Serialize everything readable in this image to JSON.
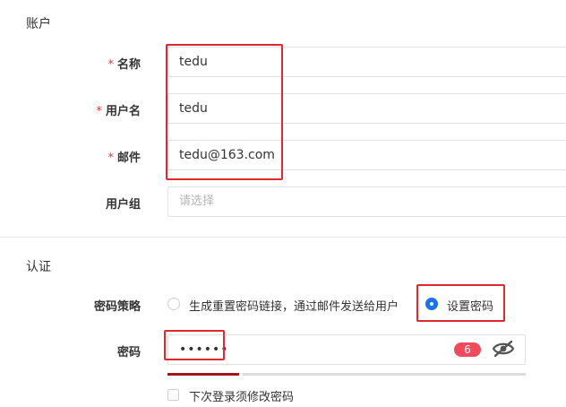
{
  "account_section": {
    "title": "账户",
    "name": {
      "required_mark": "*",
      "label": "名称",
      "value": "tedu"
    },
    "username": {
      "required_mark": "*",
      "label": "用户名",
      "value": "tedu"
    },
    "email": {
      "required_mark": "*",
      "label": "邮件",
      "value": "tedu@163.com"
    },
    "user_group": {
      "label": "用户组",
      "placeholder": "请选择"
    }
  },
  "auth_section": {
    "title": "认证",
    "password_policy": {
      "label": "密码策略",
      "options": [
        {
          "label": "生成重置密码链接，通过邮件发送给用户",
          "selected": false
        },
        {
          "label": "设置密码",
          "selected": true
        }
      ]
    },
    "password": {
      "label": "密码",
      "masked_value": "••••••",
      "length_badge": "6",
      "strength_level": 1,
      "strength_segments": 5
    },
    "force_change": {
      "label": "下次登录须修改密码",
      "checked": false
    }
  },
  "colors": {
    "highlight_border": "#e0282e",
    "required_mark": "#e0383e",
    "radio_selected": "#1a73e8",
    "badge": "#f04a5c",
    "strength_active": "#a1161c"
  }
}
